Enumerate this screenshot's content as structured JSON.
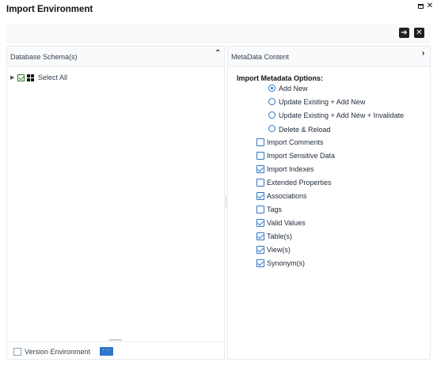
{
  "window": {
    "title": "Import Environment",
    "maximize_icon": "maximize-icon",
    "close_icon": "close-icon"
  },
  "toolbar": {
    "go_icon": "arrow-right-icon",
    "exit_icon": "close-box-icon"
  },
  "left_panel": {
    "title": "Database Schema(s)",
    "collapse_icon": "chevron-up-icon",
    "tree": {
      "select_all_label": "Select All",
      "select_all_checked": true
    },
    "footer": {
      "version_label": "Version Environment",
      "version_checked": false,
      "browse_button": "···"
    }
  },
  "right_panel": {
    "title": "MetaData Content",
    "expand_icon": "chevron-right-icon",
    "options_heading": "Import Metadata Options:",
    "radio_options": [
      {
        "label": "Add New",
        "selected": true
      },
      {
        "label": "Update Existing + Add New",
        "selected": false
      },
      {
        "label": "Update Existing + Add New + Invalidate",
        "selected": false
      },
      {
        "label": "Delete & Reload",
        "selected": false
      }
    ],
    "checkboxes": [
      {
        "label": "Import Comments",
        "checked": false
      },
      {
        "label": "Import Sensitive Data",
        "checked": false
      },
      {
        "label": "Import Indexes",
        "checked": true
      },
      {
        "label": "Extended Properties",
        "checked": false
      },
      {
        "label": "Associations",
        "checked": true
      },
      {
        "label": "Tags",
        "checked": false
      },
      {
        "label": "Valid Values",
        "checked": true
      },
      {
        "label": "Table(s)",
        "checked": true
      },
      {
        "label": "View(s)",
        "checked": true
      },
      {
        "label": "Synonym(s)",
        "checked": true
      }
    ]
  },
  "colors": {
    "accent": "#2f75c9",
    "tree_check": "#2e7d32"
  }
}
